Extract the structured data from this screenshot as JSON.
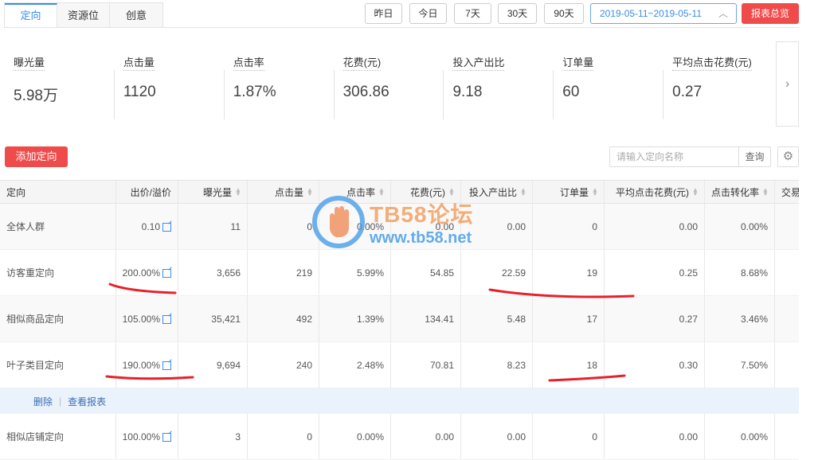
{
  "tabs": [
    {
      "label": "定向",
      "active": true
    },
    {
      "label": "资源位",
      "active": false
    },
    {
      "label": "创意",
      "active": false
    }
  ],
  "date_buttons": [
    "昨日",
    "今日",
    "7天",
    "30天",
    "90天"
  ],
  "date_range": "2019-05-11~2019-05-11",
  "report_button": "报表总览",
  "metrics": [
    {
      "label": "曝光量",
      "value": "5.98万"
    },
    {
      "label": "点击量",
      "value": "1120"
    },
    {
      "label": "点击率",
      "value": "1.87%"
    },
    {
      "label": "花费(元)",
      "value": "306.86"
    },
    {
      "label": "投入产出比",
      "value": "9.18"
    },
    {
      "label": "订单量",
      "value": "60"
    },
    {
      "label": "平均点击花费(元)",
      "value": "0.27"
    }
  ],
  "add_button": "添加定向",
  "search": {
    "placeholder": "请输入定向名称",
    "button": "查询"
  },
  "table": {
    "headers": [
      "定向",
      "出价/溢价",
      "曝光量",
      "点击量",
      "点击率",
      "花费(元)",
      "投入产出比",
      "订单量",
      "平均点击花费(元)",
      "点击转化率",
      "交易"
    ],
    "rows": [
      [
        "全体人群",
        "0.10",
        "11",
        "0",
        "0.00%",
        "0.00",
        "0.00",
        "0",
        "0.00",
        "0.00%"
      ],
      [
        "访客重定向",
        "200.00%",
        "3,656",
        "219",
        "5.99%",
        "54.85",
        "22.59",
        "19",
        "0.25",
        "8.68%"
      ],
      [
        "相似商品定向",
        "105.00%",
        "35,421",
        "492",
        "1.39%",
        "134.41",
        "5.48",
        "17",
        "0.27",
        "3.46%"
      ],
      [
        "叶子类目定向",
        "190.00%",
        "9,694",
        "240",
        "2.48%",
        "70.81",
        "8.23",
        "18",
        "0.30",
        "7.50%"
      ]
    ],
    "action_row": {
      "delete": "删除",
      "view_report": "查看报表"
    },
    "last_row": [
      "相似店铺定向",
      "100.00%",
      "3",
      "0",
      "0.00%",
      "0.00",
      "0.00",
      "0",
      "0.00",
      "0.00%"
    ]
  },
  "watermark": {
    "title": "TB58论坛",
    "url": "www.tb58.net"
  },
  "colors": {
    "accent": "#3a8ee6",
    "danger": "#f04b4b",
    "annotation": "#e8202a"
  }
}
